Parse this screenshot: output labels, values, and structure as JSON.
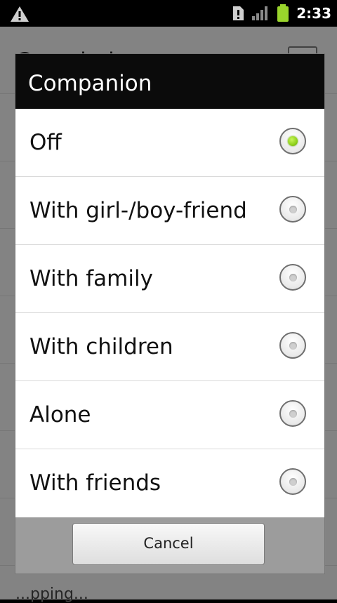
{
  "status_bar": {
    "time": "2:33",
    "icons": [
      "warning-icon",
      "sd-card-icon",
      "signal-icon",
      "battery-icon"
    ],
    "battery_color": "#9ad52c"
  },
  "background": {
    "title": "Crowdedness",
    "bottom_text": "...pping..."
  },
  "dialog": {
    "title": "Companion",
    "options": [
      {
        "label": "Off",
        "selected": true
      },
      {
        "label": "With girl-/boy-friend",
        "selected": false
      },
      {
        "label": "With family",
        "selected": false
      },
      {
        "label": "With children",
        "selected": false
      },
      {
        "label": "Alone",
        "selected": false
      },
      {
        "label": "With friends",
        "selected": false
      }
    ],
    "cancel_label": "Cancel"
  }
}
